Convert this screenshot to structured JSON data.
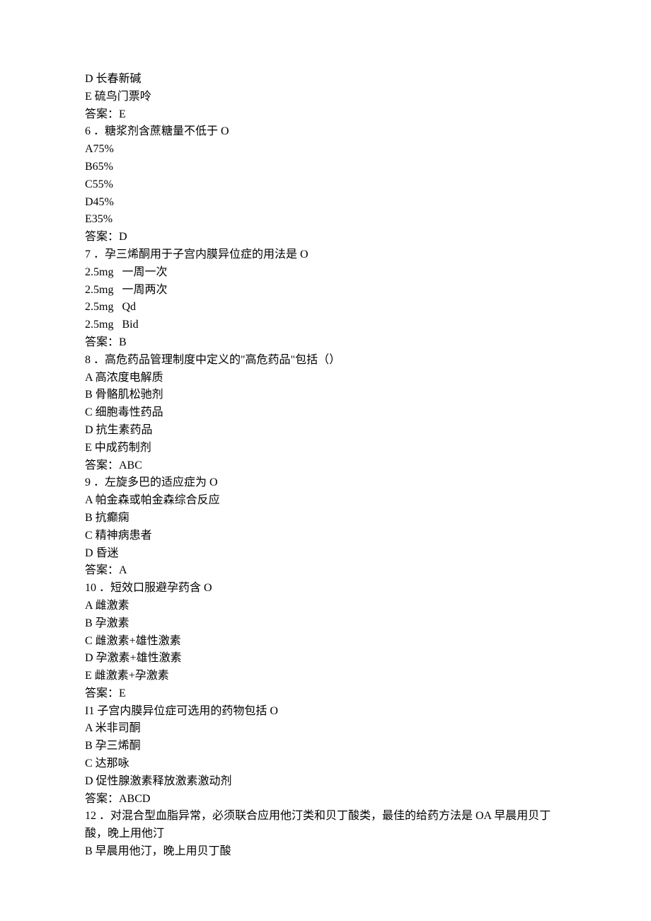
{
  "lines": [
    "D 长春新碱",
    "E 硫鸟门票呤",
    "答案：E",
    "6 ．糖浆剂含蔗糖量不低于 O",
    "A75%",
    "B65%",
    "C55%",
    "D45%",
    "E35%",
    "答案：D",
    "7 ．孕三烯酮用于子宫内膜异位症的用法是 O",
    "2.5mg   一周一次",
    "2.5mg   一周两次",
    "2.5mg   Qd",
    "2.5mg   Bid",
    "答案：B",
    "8 ．高危药品管理制度中定义的\"高危药品\"包括（）",
    "A 高浓度电解质",
    "B 骨骼肌松驰剂",
    "C 细胞毒性药品",
    "D 抗生素药品",
    "E 中成药制剂",
    "答案：ABC",
    "9 ．左旋多巴的适应症为 O",
    "A 帕金森或帕金森综合反应",
    "B 抗癫痫",
    "C 精神病患者",
    "D 昏迷",
    "答案：A",
    "10 ．短效口服避孕药含 O",
    "A 雌激素",
    "B 孕激素",
    "C 雌激素+雄性激素",
    "D 孕激素+雄性激素",
    "E 雌激素+孕激素",
    "答案：E",
    "I1 子宫内膜异位症可选用的药物包括 O",
    "A 米非司酮",
    "B 孕三烯酮",
    "C 达那咏",
    "D 促性腺激素释放激素激动剂",
    "答案：ABCD",
    "12 ．对混合型血脂异常，必须联合应用他汀类和贝丁酸类，最佳的给药方法是 OA 早晨用贝丁酸，晚上用他汀",
    "B 早晨用他汀，晚上用贝丁酸"
  ]
}
